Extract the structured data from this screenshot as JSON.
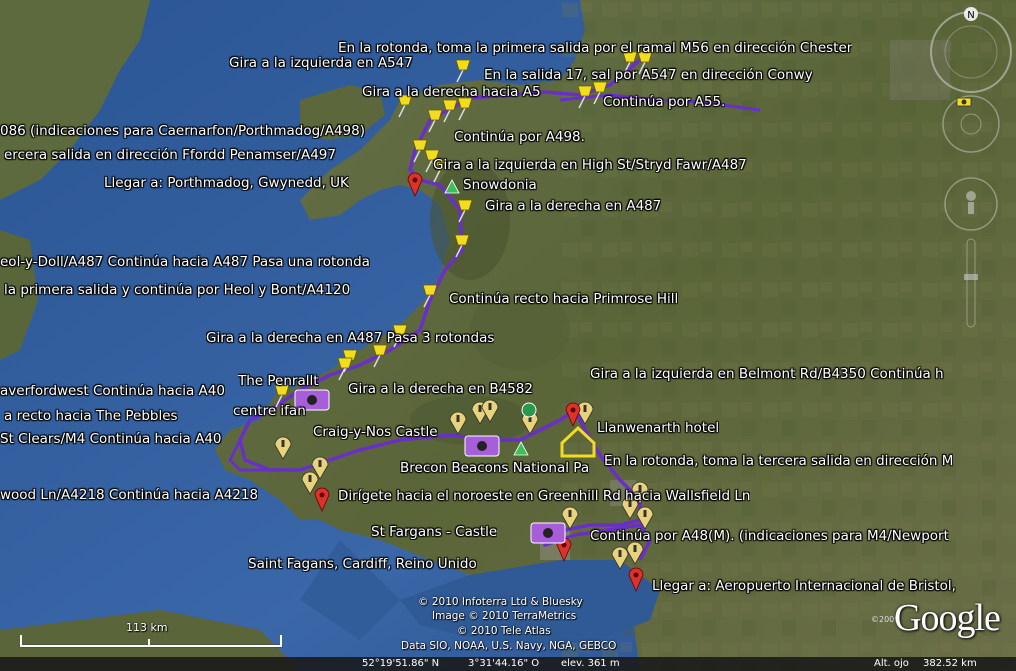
{
  "labels": [
    {
      "id": "l1",
      "text": "En la rotonda, toma la primera salida por el ramal M56 en dirección Chester"
    },
    {
      "id": "l2",
      "text": "Gira a la izquierda en A547"
    },
    {
      "id": "l3",
      "text": "En la salida 17, sal por A547 en dirección Conwy"
    },
    {
      "id": "l4",
      "text": "Gira a la derecha hacia A5"
    },
    {
      "id": "l5",
      "text": "Continúa por A55."
    },
    {
      "id": "l6",
      "text": "086 (indicaciones para Caernarfon/Porthmadog/A498)"
    },
    {
      "id": "l7",
      "text": "Continúa por A498."
    },
    {
      "id": "l8",
      "text": "ercera salida en dirección Ffordd Penamser/A497"
    },
    {
      "id": "l9",
      "text": "Gira a la izquierda en High St/Stryd Fawr/A487"
    },
    {
      "id": "l10",
      "text": "Llegar a: Porthmadog, Gwynedd, UK"
    },
    {
      "id": "l11",
      "text": "Snowdonia"
    },
    {
      "id": "l12",
      "text": "Gira a la derecha en A487"
    },
    {
      "id": "l13",
      "text": "eol-y-Doll/A487  Continúa hacia A487 Pasa una rotonda"
    },
    {
      "id": "l14",
      "text": "la primera salida y continúa por Heol y Bont/A4120"
    },
    {
      "id": "l15",
      "text": "Continúa recto hacia Primrose Hill"
    },
    {
      "id": "l16",
      "text": "Gira a la derecha en A487   Pasa 3 rotondas"
    },
    {
      "id": "l17",
      "text": "The Penrallt"
    },
    {
      "id": "l18",
      "text": "Gira a la derecha en B4582"
    },
    {
      "id": "l19",
      "text": "Gira a la izquierda en Belmont Rd/B4350  Continúa h"
    },
    {
      "id": "l20",
      "text": "averfordwest  Continúa hacia A40"
    },
    {
      "id": "l21",
      "text": "centre ifan"
    },
    {
      "id": "l22",
      "text": "a recto hacia The Pebbles"
    },
    {
      "id": "l23",
      "text": "Llanwenarth hotel"
    },
    {
      "id": "l24",
      "text": "Craig-y-Nos Castle"
    },
    {
      "id": "l25",
      "text": "St Clears/M4  Continúa hacia A40"
    },
    {
      "id": "l26",
      "text": "Brecon Beacons National Pa"
    },
    {
      "id": "l27",
      "text": "En la rotonda, toma la tercera salida en dirección M"
    },
    {
      "id": "l28",
      "text": "wood Ln/A4218  Continúa hacia A4218"
    },
    {
      "id": "l29",
      "text": "Dirígete hacia el noroeste en Greenhill Rd hacia Wallsfield Ln"
    },
    {
      "id": "l30",
      "text": "St Fargans - Castle"
    },
    {
      "id": "l31",
      "text": "Continúa por A48(M). (indicaciones para M4/Newport"
    },
    {
      "id": "l32",
      "text": "Saint Fagans, Cardiff, Reino Unido"
    },
    {
      "id": "l33",
      "text": "Llegar a: Aeropuerto Internacional de Bristol,"
    }
  ],
  "copyright": [
    "© 2010 Infoterra Ltd & Bluesky",
    "Image © 2010 TerraMetrics",
    "© 2010 Tele Atlas",
    "Data SIO, NOAA, U.S. Navy, NGA, GEBCO"
  ],
  "scale": {
    "label": "113 km"
  },
  "brand": {
    "name": "Google",
    "year": "©2009"
  },
  "status": {
    "lat": "52°19'51.86\" N",
    "lon": "3°31'44.16\" O",
    "elev": "elev.  361 m",
    "eye_label": "Alt. ojo",
    "eye": "382.52 km"
  },
  "nav": {
    "north": "N"
  },
  "colors": {
    "route": "#6a2fc8",
    "sea": "#2d5a9c",
    "land": "#5f6a3a",
    "pushpin": "#f2dc1f",
    "placemark_red": "#d9332b"
  }
}
